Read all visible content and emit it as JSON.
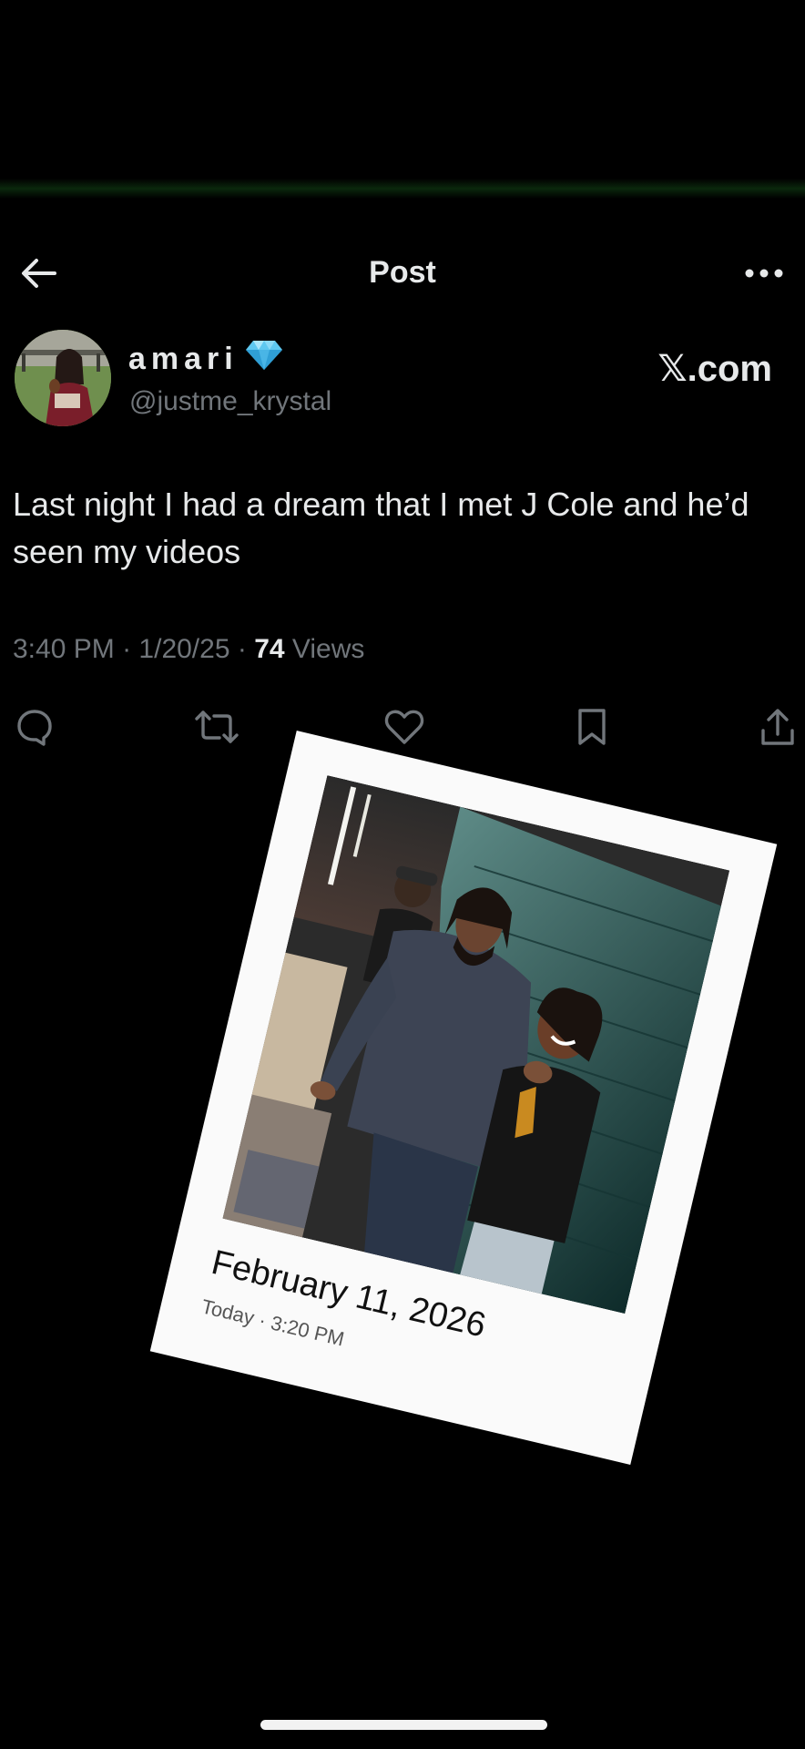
{
  "header": {
    "title": "Post"
  },
  "author": {
    "display_name": "amari",
    "handle": "@justme_krystal",
    "verified_badge_icon": "diamond-icon"
  },
  "watermark": "𝕏.com",
  "tweet": {
    "text": "Last night I had a dream that I met J Cole and he’d seen my videos",
    "time": "3:40 PM",
    "date": "1/20/25",
    "separator": "·",
    "views_count": "74",
    "views_label": "Views"
  },
  "actions": [
    {
      "name": "reply",
      "icon": "comment-icon"
    },
    {
      "name": "repost",
      "icon": "repost-icon"
    },
    {
      "name": "like",
      "icon": "heart-icon"
    },
    {
      "name": "bookmark",
      "icon": "bookmark-icon"
    },
    {
      "name": "share",
      "icon": "share-icon"
    }
  ],
  "polaroid": {
    "date": "February 11, 2026",
    "subtitle": "Today · 3:20 PM"
  },
  "colors": {
    "background": "#000000",
    "text_primary": "#e7e9ea",
    "text_secondary": "#71767b",
    "verified_diamond": "#5ec8f0",
    "polaroid_frame": "#fafafa"
  }
}
